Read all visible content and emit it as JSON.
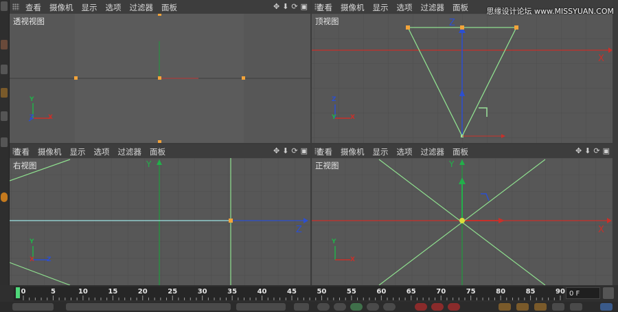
{
  "menu": [
    "查看",
    "摄像机",
    "显示",
    "选项",
    "过滤器",
    "面板"
  ],
  "nav_icons": [
    "move-icon",
    "down-arrow-icon",
    "rotate-icon",
    "maximize-icon"
  ],
  "watermark": "思缘设计论坛 www.MISSYUAN.COM",
  "viewports": {
    "perspective": {
      "label": "透视视图"
    },
    "top": {
      "label": "顶视图",
      "axis_x": "X",
      "axis_z": "Z"
    },
    "right": {
      "label": "右视图",
      "axis_y": "Y",
      "axis_z": "Z"
    },
    "front": {
      "label": "正视图",
      "axis_y": "Y",
      "axis_x": "X"
    }
  },
  "gizmo": {
    "x": "X",
    "y": "Y",
    "z": "Z"
  },
  "timeline": {
    "ticks": [
      "0",
      "5",
      "10",
      "15",
      "20",
      "25",
      "30",
      "35",
      "40",
      "45",
      "50",
      "55",
      "60",
      "65",
      "70",
      "75",
      "80",
      "85",
      "90"
    ],
    "current_frame": "0 F"
  },
  "colors": {
    "axis_x": "#c8302a",
    "axis_y": "#22b04a",
    "axis_z": "#2c4fd0",
    "camera": "#9be39b",
    "point": "#f2a33a",
    "grid": "#4d4d4d"
  }
}
